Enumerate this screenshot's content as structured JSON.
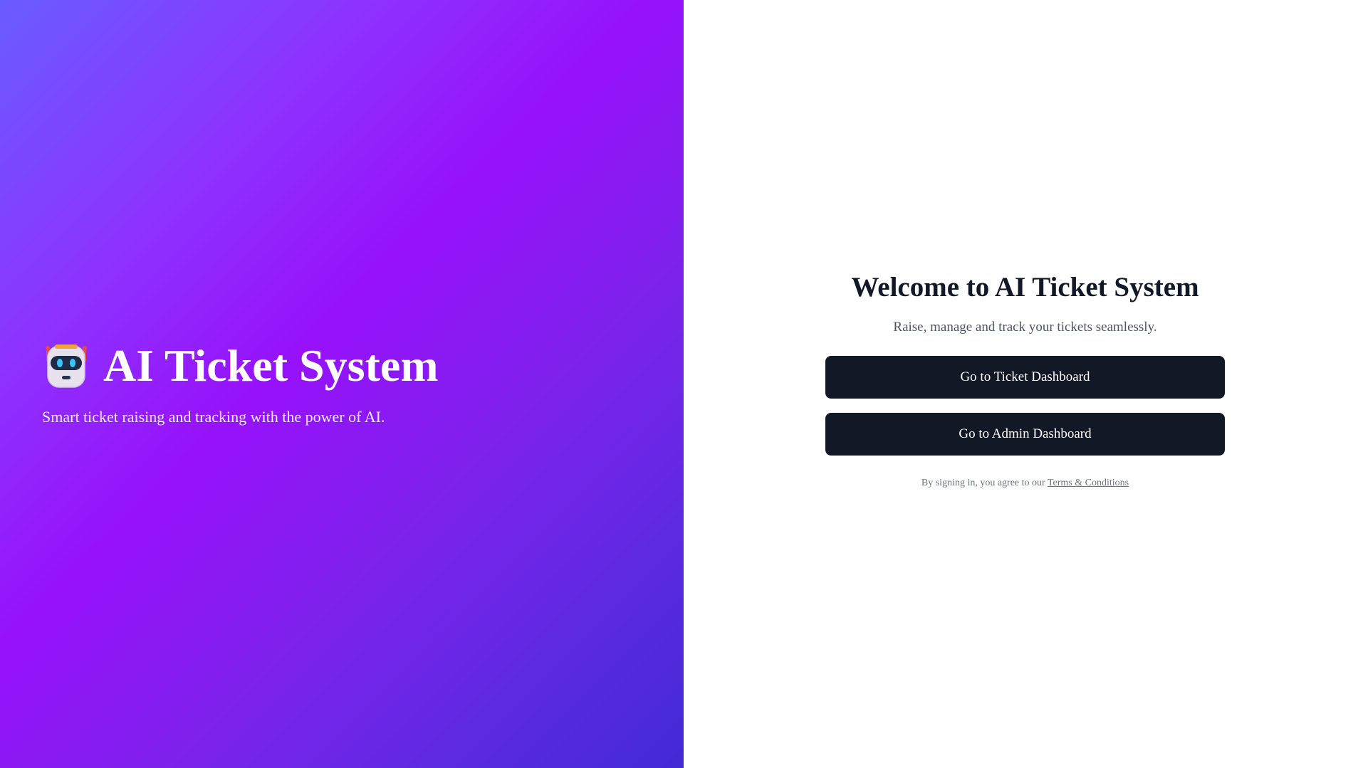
{
  "hero": {
    "icon": "robot-icon",
    "title": "AI Ticket System",
    "subtitle": "Smart ticket raising and tracking with the power of AI."
  },
  "panel": {
    "heading": "Welcome to AI Ticket System",
    "tagline": "Raise, manage and track your tickets seamlessly.",
    "ticket_button_label": "Go to Ticket Dashboard",
    "admin_button_label": "Go to Admin Dashboard",
    "terms_prefix": "By signing in, you agree to our ",
    "terms_link": "Terms & Conditions"
  },
  "colors": {
    "button_bg": "#121826",
    "heading": "#111827",
    "gradient_start": "#6a5cff",
    "gradient_mid": "#9711fa",
    "gradient_end": "#4329d6"
  }
}
